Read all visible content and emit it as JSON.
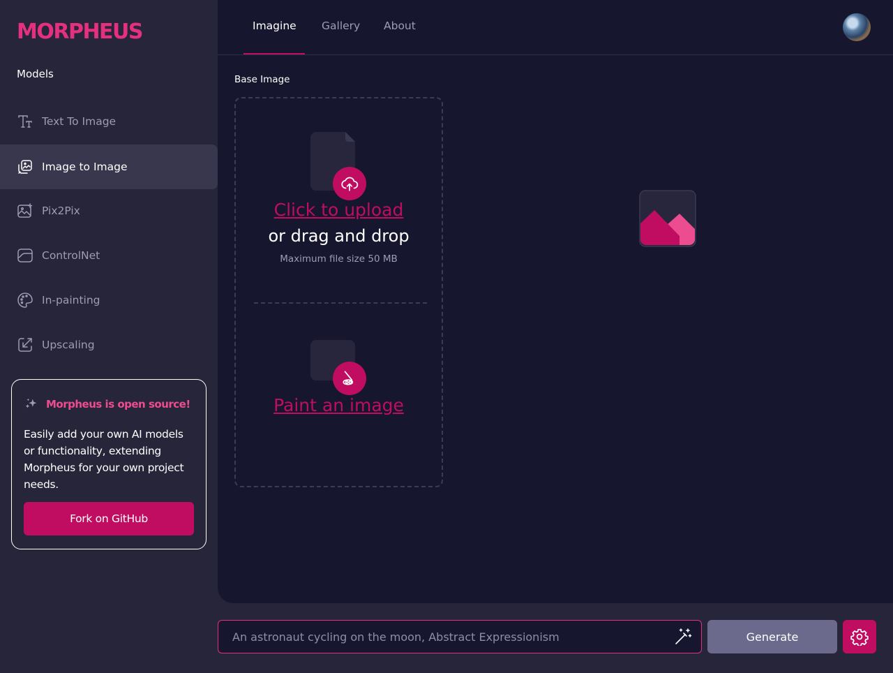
{
  "brand": {
    "name": "MORPHEUS"
  },
  "sidebar": {
    "heading": "Models",
    "items": [
      {
        "label": "Text To Image",
        "icon": "text-icon",
        "active": false
      },
      {
        "label": "Image to Image",
        "icon": "image-swap-icon",
        "active": true
      },
      {
        "label": "Pix2Pix",
        "icon": "image-sparkle-icon",
        "active": false
      },
      {
        "label": "ControlNet",
        "icon": "controlnet-icon",
        "active": false
      },
      {
        "label": "In-painting",
        "icon": "palette-icon",
        "active": false
      },
      {
        "label": "Upscaling",
        "icon": "upscale-icon",
        "active": false
      }
    ],
    "promo": {
      "title": "Morpheus is open source!",
      "text": "Easily add your own AI models or functionality, extending Morpheus for your own project needs.",
      "button": "Fork on GitHub"
    }
  },
  "topbar": {
    "tabs": [
      {
        "label": "Imagine",
        "active": true
      },
      {
        "label": "Gallery",
        "active": false
      },
      {
        "label": "About",
        "active": false
      }
    ]
  },
  "main": {
    "base_image_label": "Base Image",
    "upload_link": "Click to upload",
    "drag_text": "or drag and drop",
    "max_size": "Maximum file size 50 MB",
    "paint_link": "Paint an image"
  },
  "prompt": {
    "placeholder": "An astronaut cycling on the moon, Abstract Expressionism",
    "value": "",
    "generate_label": "Generate"
  },
  "colors": {
    "accent": "#c00d62",
    "brand": "#e5307f",
    "sidebar_bg": "#262539",
    "main_bg": "#16172e",
    "generate_bg": "#6b6a8c"
  }
}
